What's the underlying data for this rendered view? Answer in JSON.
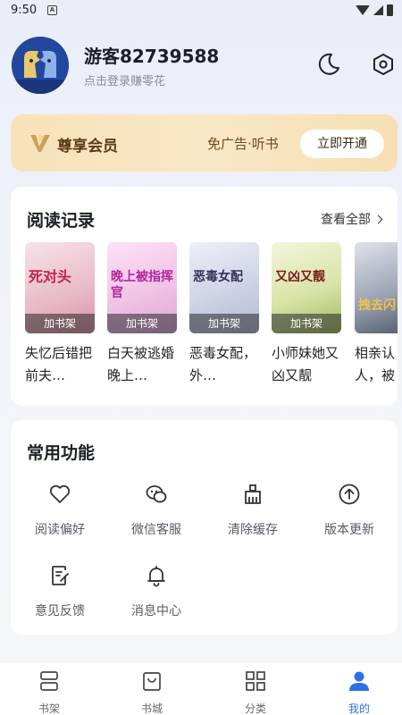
{
  "status_bar": {
    "time": "9:50",
    "notif_glyph": "A"
  },
  "profile": {
    "username": "游客82739588",
    "hint": "点击登录赚零花",
    "icons": [
      "night-mode-icon",
      "settings-icon"
    ]
  },
  "vip": {
    "title": "尊享会员",
    "benefits": "免广告·听书",
    "button": "立即开通"
  },
  "reading_history": {
    "title": "阅读记录",
    "view_all": "查看全部",
    "add_label": "加书架",
    "books": [
      {
        "title": "失忆后错把前夫…",
        "cover_text": "死对头",
        "cover_color": "#f2d6de"
      },
      {
        "title": "白天被逃婚晚上…",
        "cover_text": "晚上被指挥官",
        "cover_color": "#f3dcf0"
      },
      {
        "title": "恶毒女配，外…",
        "cover_text": "恶毒女配",
        "cover_color": "#e8e6f0"
      },
      {
        "title": "小师妹她又凶又靓",
        "cover_text": "又凶又靓",
        "cover_color": "#eef2d6"
      },
      {
        "title": "相亲认人，被",
        "cover_text": "拽去闪",
        "cover_color": "#cfd4dc"
      }
    ]
  },
  "common_functions": {
    "title": "常用功能",
    "items": [
      {
        "label": "阅读偏好",
        "icon": "heart-icon"
      },
      {
        "label": "微信客服",
        "icon": "wechat-icon"
      },
      {
        "label": "清除缓存",
        "icon": "broom-icon"
      },
      {
        "label": "版本更新",
        "icon": "upload-icon"
      },
      {
        "label": "意见反馈",
        "icon": "feedback-icon"
      },
      {
        "label": "消息中心",
        "icon": "bell-icon"
      }
    ]
  },
  "bottom_nav": {
    "items": [
      {
        "label": "书架",
        "icon": "bookshelf-icon"
      },
      {
        "label": "书城",
        "icon": "store-icon"
      },
      {
        "label": "分类",
        "icon": "category-icon"
      },
      {
        "label": "我的",
        "icon": "profile-icon"
      }
    ],
    "active": "我的"
  },
  "colors": {
    "accent": "#2e6fe6",
    "vip_bg": "#f7e2b8",
    "vip_text": "#5b3c17"
  }
}
